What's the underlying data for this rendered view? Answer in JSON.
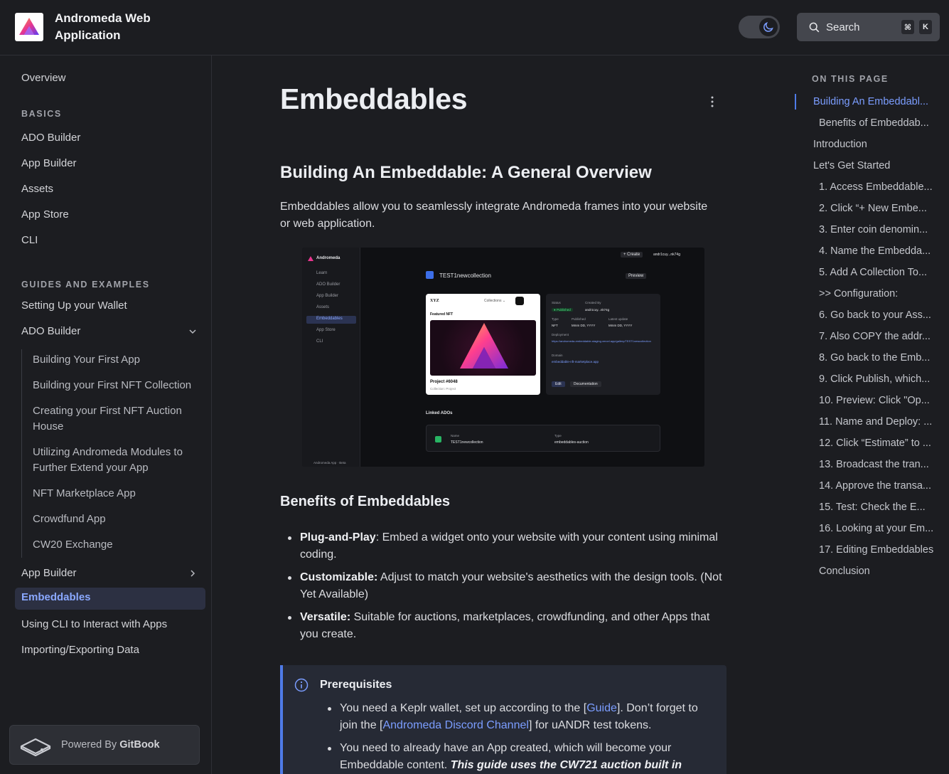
{
  "header": {
    "app_title": "Andromeda Web Application",
    "search_label": "Search",
    "shortcut_keys": [
      "⌘",
      "K"
    ],
    "theme_mode": "dark"
  },
  "sidebar": {
    "overview": "Overview",
    "basics_heading": "BASICS",
    "basics": [
      "ADO Builder",
      "App Builder",
      "Assets",
      "App Store",
      "CLI"
    ],
    "guides_heading": "GUIDES AND EXAMPLES",
    "setting_up_wallet": "Setting Up your Wallet",
    "ado_builder_group": "ADO Builder",
    "ado_builder_children": [
      "Building Your First App",
      "Building your First NFT Collection",
      "Creating your First NFT Auction House",
      "Utilizing Andromeda Modules to Further Extend your App",
      "NFT Marketplace App",
      "Crowdfund App",
      "CW20 Exchange"
    ],
    "app_builder_group": "App Builder",
    "embeddables": "Embeddables",
    "using_cli": "Using CLI to Interact with Apps",
    "importing": "Importing/Exporting Data",
    "powered_prefix": "Powered By",
    "powered_brand": "GitBook"
  },
  "main": {
    "title": "Embeddables",
    "section_heading": "Building An Embeddable: A General Overview",
    "intro": "Embeddables allow you to seamlessly integrate Andromeda frames into your website or web application.",
    "benefits_heading": "Benefits of Embeddables",
    "benefits": [
      {
        "label": "Plug-and-Play",
        "sep": ": ",
        "text": "Embed a widget onto your website with your content using minimal coding."
      },
      {
        "label": "Customizable:",
        "sep": " ",
        "text": "Adjust to match your website's aesthetics with the design tools. (Not Yet Available)"
      },
      {
        "label": "Versatile:",
        "sep": " ",
        "text": "Suitable for auctions, marketplaces, crowdfunding, and other Apps that you create."
      }
    ],
    "prereq_title": "Prerequisites",
    "prereq_1_a": "You need a Keplr wallet, set up according to the [",
    "prereq_1_link1": "Guide",
    "prereq_1_b": "]. Don’t forget to join the [",
    "prereq_1_link2": "Andromeda Discord Channel",
    "prereq_1_c": "] for uANDR test tokens.",
    "prereq_2_a": "You need to already have an App created, which will become your Embeddable content.",
    "prereq_2_bold": "This guide uses the CW721 auction built in",
    "accent_color": "#4f7be8",
    "link_color": "#7b9dff"
  },
  "screenshot": {
    "brand": "Andromeda",
    "nav": [
      "Learn",
      "ADO Builder",
      "App Builder",
      "Assets",
      "Embeddables",
      "App Store",
      "CLI"
    ],
    "collection_title": "TEST1newcollection",
    "preview_label": "Preview",
    "create_label": "+ Create",
    "card_brand": "XYZ",
    "card_menu": "Collections ⌄",
    "featured": "Featured NFT",
    "project": "Project #6048",
    "project_sub": "Collection: Project",
    "status_label": "Status",
    "status_value": "● Published",
    "created_by_label": "Created By",
    "created_by_value": "andr1cuy...nk74g",
    "type_label": "Type",
    "type_value": "NFT",
    "published_label": "Published",
    "published_value": "Mmm DD, YYYY",
    "updated_label": "Latest update",
    "updated_value": "Mmm DD, YYYY",
    "deployment_label": "Deployment",
    "deployment_value": "https://andromeda-embeddable-staging.vercel.app/gallery/TEST1newcollection",
    "domain_label": "Domain",
    "domain_value": "embeddable-nft-marketplace.app",
    "edit_label": "Edit",
    "docs_label": "Documentation",
    "linked_heading": "Linked ADOs",
    "row_name_label": "Name",
    "row_name_value": "TEST1newcollection",
    "row_type_label": "Type",
    "row_type_value": "embeddables-auction",
    "footer": "Andromeda App · Beta"
  },
  "toc": {
    "heading": "ON THIS PAGE",
    "items": [
      {
        "text": "Building An Embeddabl...",
        "level": 1,
        "active": true
      },
      {
        "text": "Benefits of Embeddab...",
        "level": 2
      },
      {
        "text": "Introduction",
        "level": 1
      },
      {
        "text": "Let's Get Started",
        "level": 1
      },
      {
        "text": "1. Access Embeddable...",
        "level": 2
      },
      {
        "text": "2. Click “+ New Embe...",
        "level": 2
      },
      {
        "text": "3. Enter coin denomin...",
        "level": 2
      },
      {
        "text": "4. Name the Embedda...",
        "level": 2
      },
      {
        "text": "5. Add A Collection To...",
        "level": 2
      },
      {
        "text": ">> Configuration:",
        "level": 2
      },
      {
        "text": "6. Go back to your Ass...",
        "level": 2
      },
      {
        "text": "7. Also COPY the addr...",
        "level": 2
      },
      {
        "text": "8. Go back to the Emb...",
        "level": 2
      },
      {
        "text": "9. Click Publish, which...",
        "level": 2
      },
      {
        "text": "10. Preview: Click \"Op...",
        "level": 2
      },
      {
        "text": "11. Name and Deploy: ...",
        "level": 2
      },
      {
        "text": "12. Click “Estimate” to ...",
        "level": 2
      },
      {
        "text": "13. Broadcast the tran...",
        "level": 2
      },
      {
        "text": "14. Approve the transa...",
        "level": 2
      },
      {
        "text": "15. Test: Check the E...",
        "level": 2
      },
      {
        "text": "16. Looking at your Em...",
        "level": 2
      },
      {
        "text": "17. Editing Embeddables",
        "level": 2
      },
      {
        "text": "Conclusion",
        "level": 2
      }
    ]
  }
}
